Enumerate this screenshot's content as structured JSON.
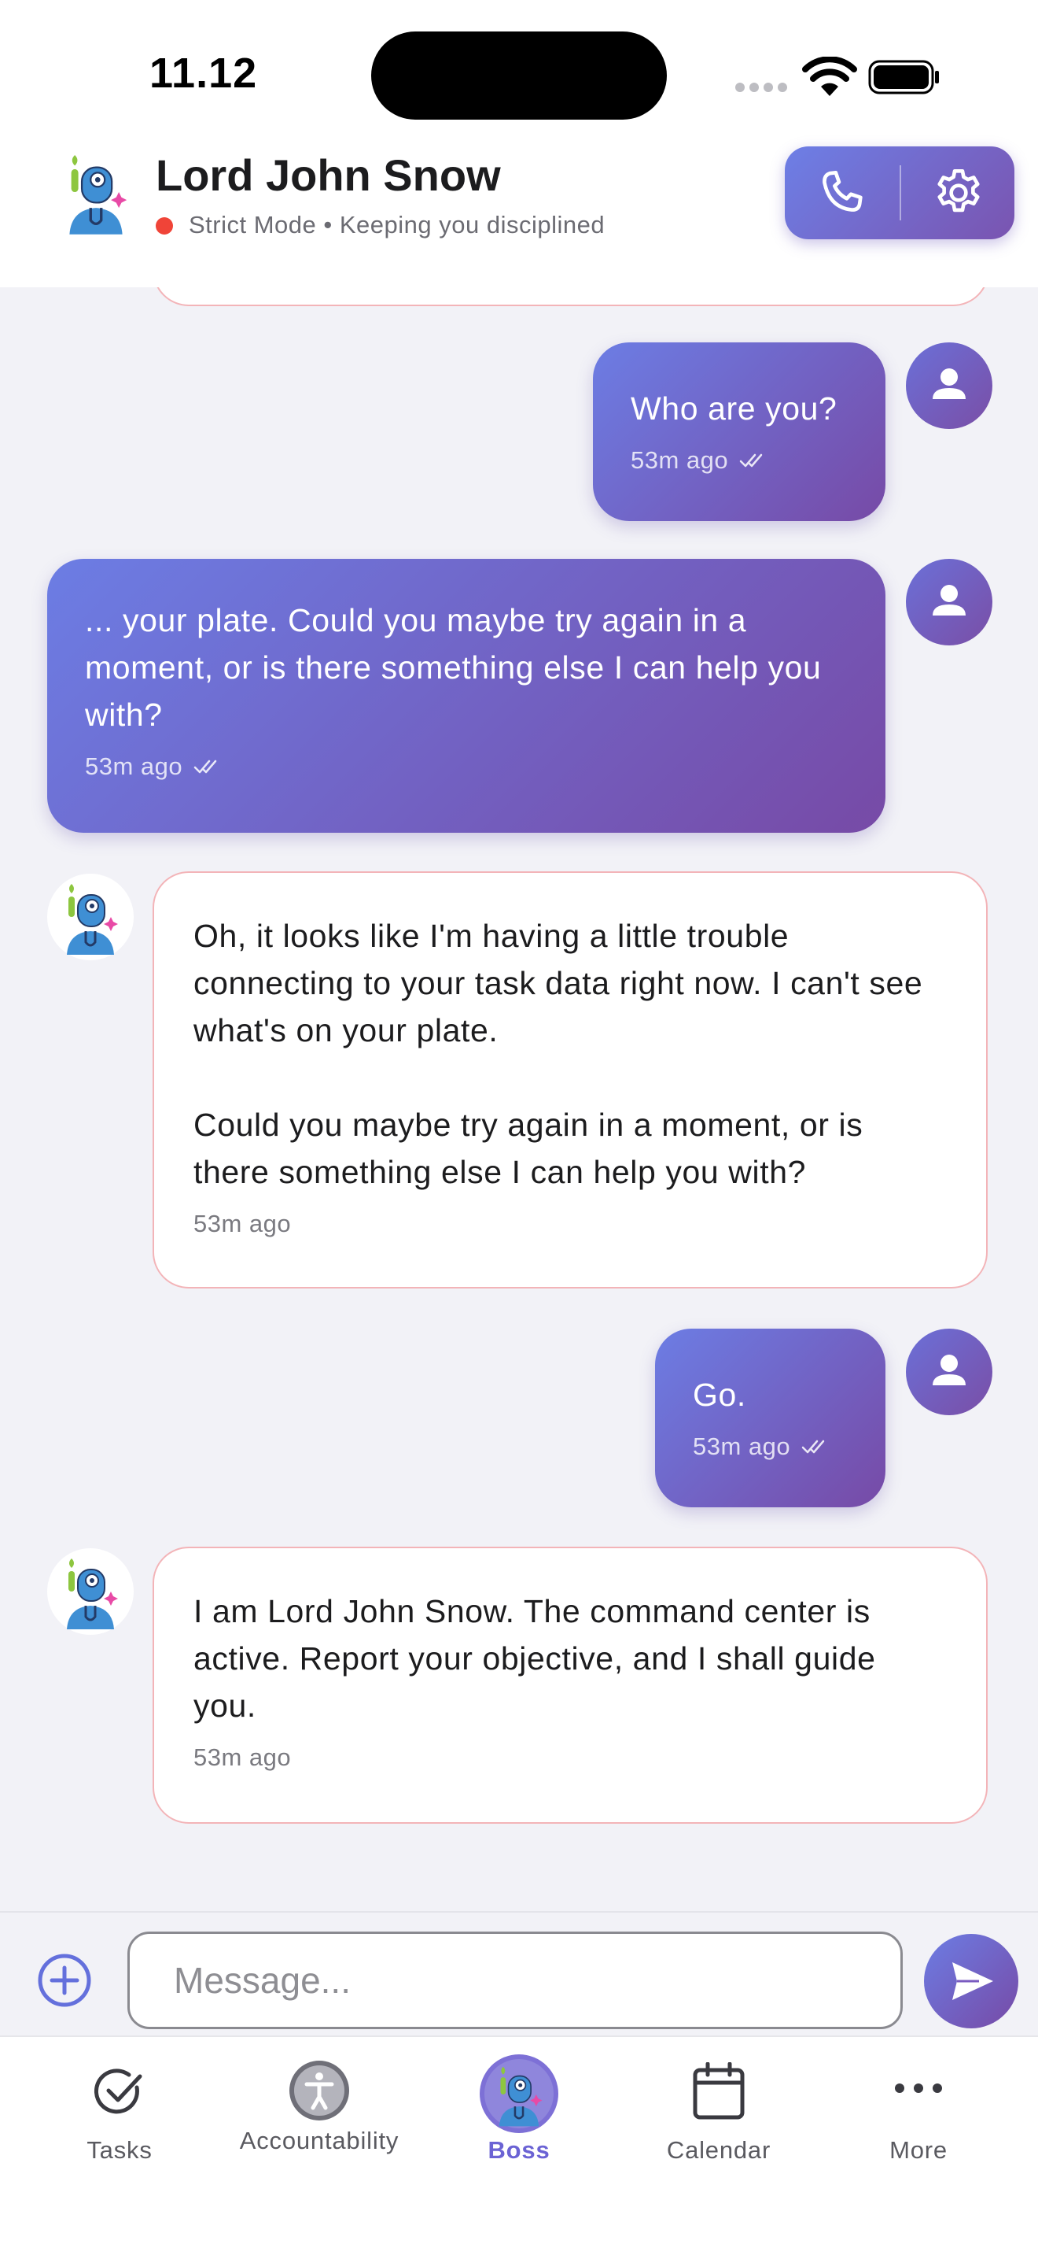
{
  "status_bar": {
    "time": "11.12"
  },
  "header": {
    "title": "Lord John Snow",
    "mode": "Strict Mode",
    "subtitle_suffix": "Keeping you disciplined",
    "subtitle": "Strict Mode • Keeping you disciplined",
    "accent_gradient": [
      "#6d7fe6",
      "#7a54b0"
    ],
    "mode_color": "#f04438"
  },
  "messages": [
    {
      "sender": "user",
      "text": "Who are you?",
      "time": "53m ago",
      "read": true
    },
    {
      "sender": "user",
      "text": "... your plate. Could you maybe try again in a moment, or is there something else I can help you with?",
      "time": "53m ago",
      "read": true
    },
    {
      "sender": "bot",
      "text": "Oh, it looks like I'm having a little trouble connecting to your task data right now. I can't see what's on your plate.\n\nCould you maybe try again in a moment, or is there something else I can help you with?",
      "time": "53m ago"
    },
    {
      "sender": "user",
      "text": "Go.",
      "time": "53m ago",
      "read": true
    },
    {
      "sender": "bot",
      "text": "I am Lord John Snow. The command center is active. Report your objective, and I shall guide you.",
      "time": "53m ago"
    }
  ],
  "composer": {
    "placeholder": "Message..."
  },
  "tabs": [
    {
      "label": "Tasks",
      "icon": "check-circle-icon",
      "active": false
    },
    {
      "label": "Accountability",
      "icon": "accessibility-icon",
      "active": false
    },
    {
      "label": "Boss",
      "icon": "robot-avatar-icon",
      "active": true
    },
    {
      "label": "Calendar",
      "icon": "calendar-icon",
      "active": false
    },
    {
      "label": "More",
      "icon": "more-dots-icon",
      "active": false
    }
  ]
}
